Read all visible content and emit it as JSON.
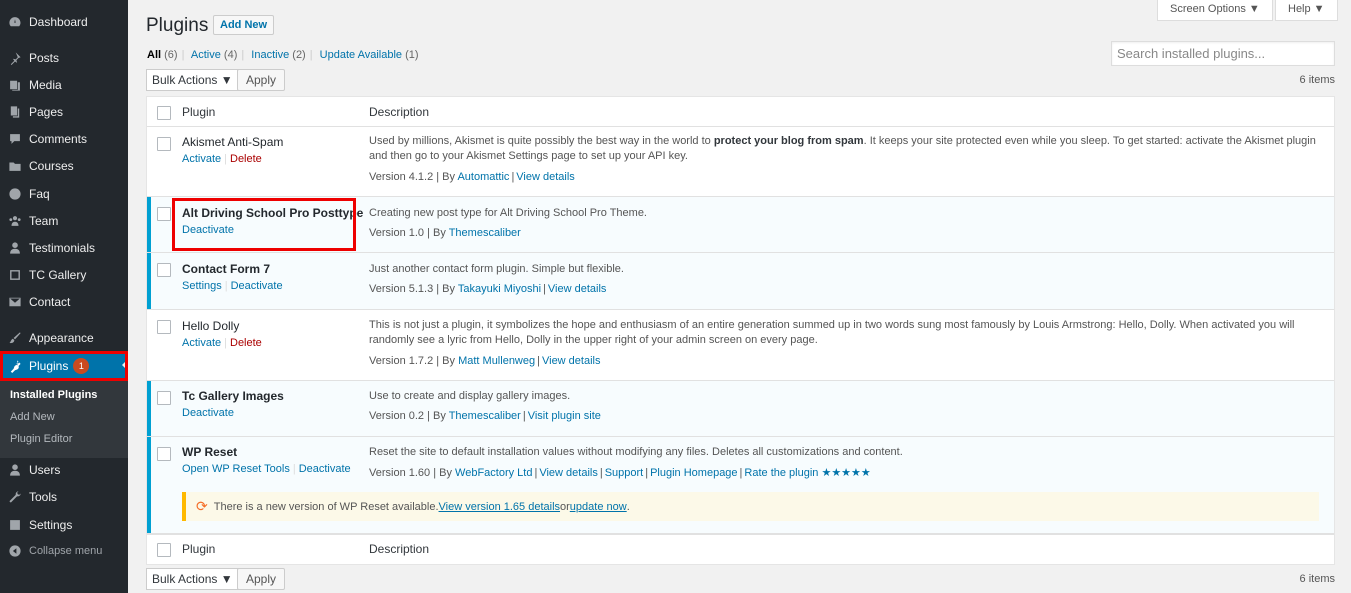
{
  "sidebar": {
    "items": [
      {
        "label": "Dashboard",
        "icon": "dashboard-icon"
      },
      {
        "label": "Posts",
        "icon": "pin-icon"
      },
      {
        "label": "Media",
        "icon": "media-icon"
      },
      {
        "label": "Pages",
        "icon": "pages-icon"
      },
      {
        "label": "Comments",
        "icon": "comments-icon"
      },
      {
        "label": "Courses",
        "icon": "folder-icon"
      },
      {
        "label": "Faq",
        "icon": "question-icon"
      },
      {
        "label": "Team",
        "icon": "groups-icon"
      },
      {
        "label": "Testimonials",
        "icon": "person-icon"
      },
      {
        "label": "TC Gallery",
        "icon": "gallery-icon"
      },
      {
        "label": "Contact",
        "icon": "mail-icon"
      },
      {
        "label": "Appearance",
        "icon": "brush-icon"
      },
      {
        "label": "Plugins",
        "icon": "plugin-icon",
        "badge": "1"
      },
      {
        "label": "Users",
        "icon": "users-icon"
      },
      {
        "label": "Tools",
        "icon": "wrench-icon"
      },
      {
        "label": "Settings",
        "icon": "settings-icon"
      }
    ],
    "submenu": [
      "Installed Plugins",
      "Add New",
      "Plugin Editor"
    ],
    "collapse": "Collapse menu"
  },
  "header": {
    "title": "Plugins",
    "add_new": "Add New",
    "screen_options": "Screen Options ▼",
    "help": "Help ▼"
  },
  "filters": [
    {
      "label": "All",
      "count": "(6)"
    },
    {
      "label": "Active",
      "count": "(4)"
    },
    {
      "label": "Inactive",
      "count": "(2)"
    },
    {
      "label": "Update Available",
      "count": "(1)"
    }
  ],
  "search": {
    "placeholder": "Search installed plugins..."
  },
  "bulk": {
    "label": "Bulk Actions ▼",
    "apply": "Apply",
    "items": "6 items"
  },
  "table": {
    "col_plugin": "Plugin",
    "col_description": "Description"
  },
  "plugins": [
    {
      "name": "Akismet Anti-Spam",
      "actions": [
        "Activate",
        "Delete"
      ],
      "desc_pre": "Used by millions, Akismet is quite possibly the best way in the world to ",
      "desc_bold": "protect your blog from spam",
      "desc_post": ". It keeps your site protected even while you sleep. To get started: activate the Akismet plugin and then go to your Akismet Settings page to set up your API key.",
      "version": "Version 4.1.2 | By ",
      "author": "Automattic",
      "links": [
        "View details"
      ]
    },
    {
      "name": "Alt Driving School Pro Posttype",
      "actions": [
        "Deactivate"
      ],
      "desc": "Creating new post type for Alt Driving School Pro Theme.",
      "version": "Version 1.0 | By ",
      "author": "Themescaliber",
      "links": []
    },
    {
      "name": "Contact Form 7",
      "actions": [
        "Settings",
        "Deactivate"
      ],
      "desc": "Just another contact form plugin. Simple but flexible.",
      "version": "Version 5.1.3 | By ",
      "author": "Takayuki Miyoshi",
      "links": [
        "View details"
      ]
    },
    {
      "name": "Hello Dolly",
      "actions": [
        "Activate",
        "Delete"
      ],
      "desc": "This is not just a plugin, it symbolizes the hope and enthusiasm of an entire generation summed up in two words sung most famously by Louis Armstrong: Hello, Dolly. When activated you will randomly see a lyric from Hello, Dolly in the upper right of your admin screen on every page.",
      "version": "Version 1.7.2 | By ",
      "author": "Matt Mullenweg",
      "links": [
        "View details"
      ]
    },
    {
      "name": "Tc Gallery Images",
      "actions": [
        "Deactivate"
      ],
      "desc": "Use to create and display gallery images.",
      "version": "Version 0.2 | By ",
      "author": "Themescaliber",
      "links": [
        "Visit plugin site"
      ]
    },
    {
      "name": "WP Reset",
      "actions": [
        "Open WP Reset Tools",
        "Deactivate"
      ],
      "desc": "Reset the site to default installation values without modifying any files. Deletes all customizations and content.",
      "version": "Version 1.60 | By ",
      "author": "WebFactory Ltd",
      "links": [
        "View details",
        "Support",
        "Plugin Homepage",
        "Rate the plugin ★★★★★"
      ]
    }
  ],
  "update_notice": {
    "text": "There is a new version of WP Reset available. ",
    "link1": "View version 1.65 details",
    "mid": " or ",
    "link2": "update now",
    "end": "."
  },
  "colors": {
    "accent": "#0073aa",
    "sidebar": "#23282d",
    "active_border": "#00a0d2",
    "highlight": "#ee0000",
    "delete": "#aa0000"
  }
}
